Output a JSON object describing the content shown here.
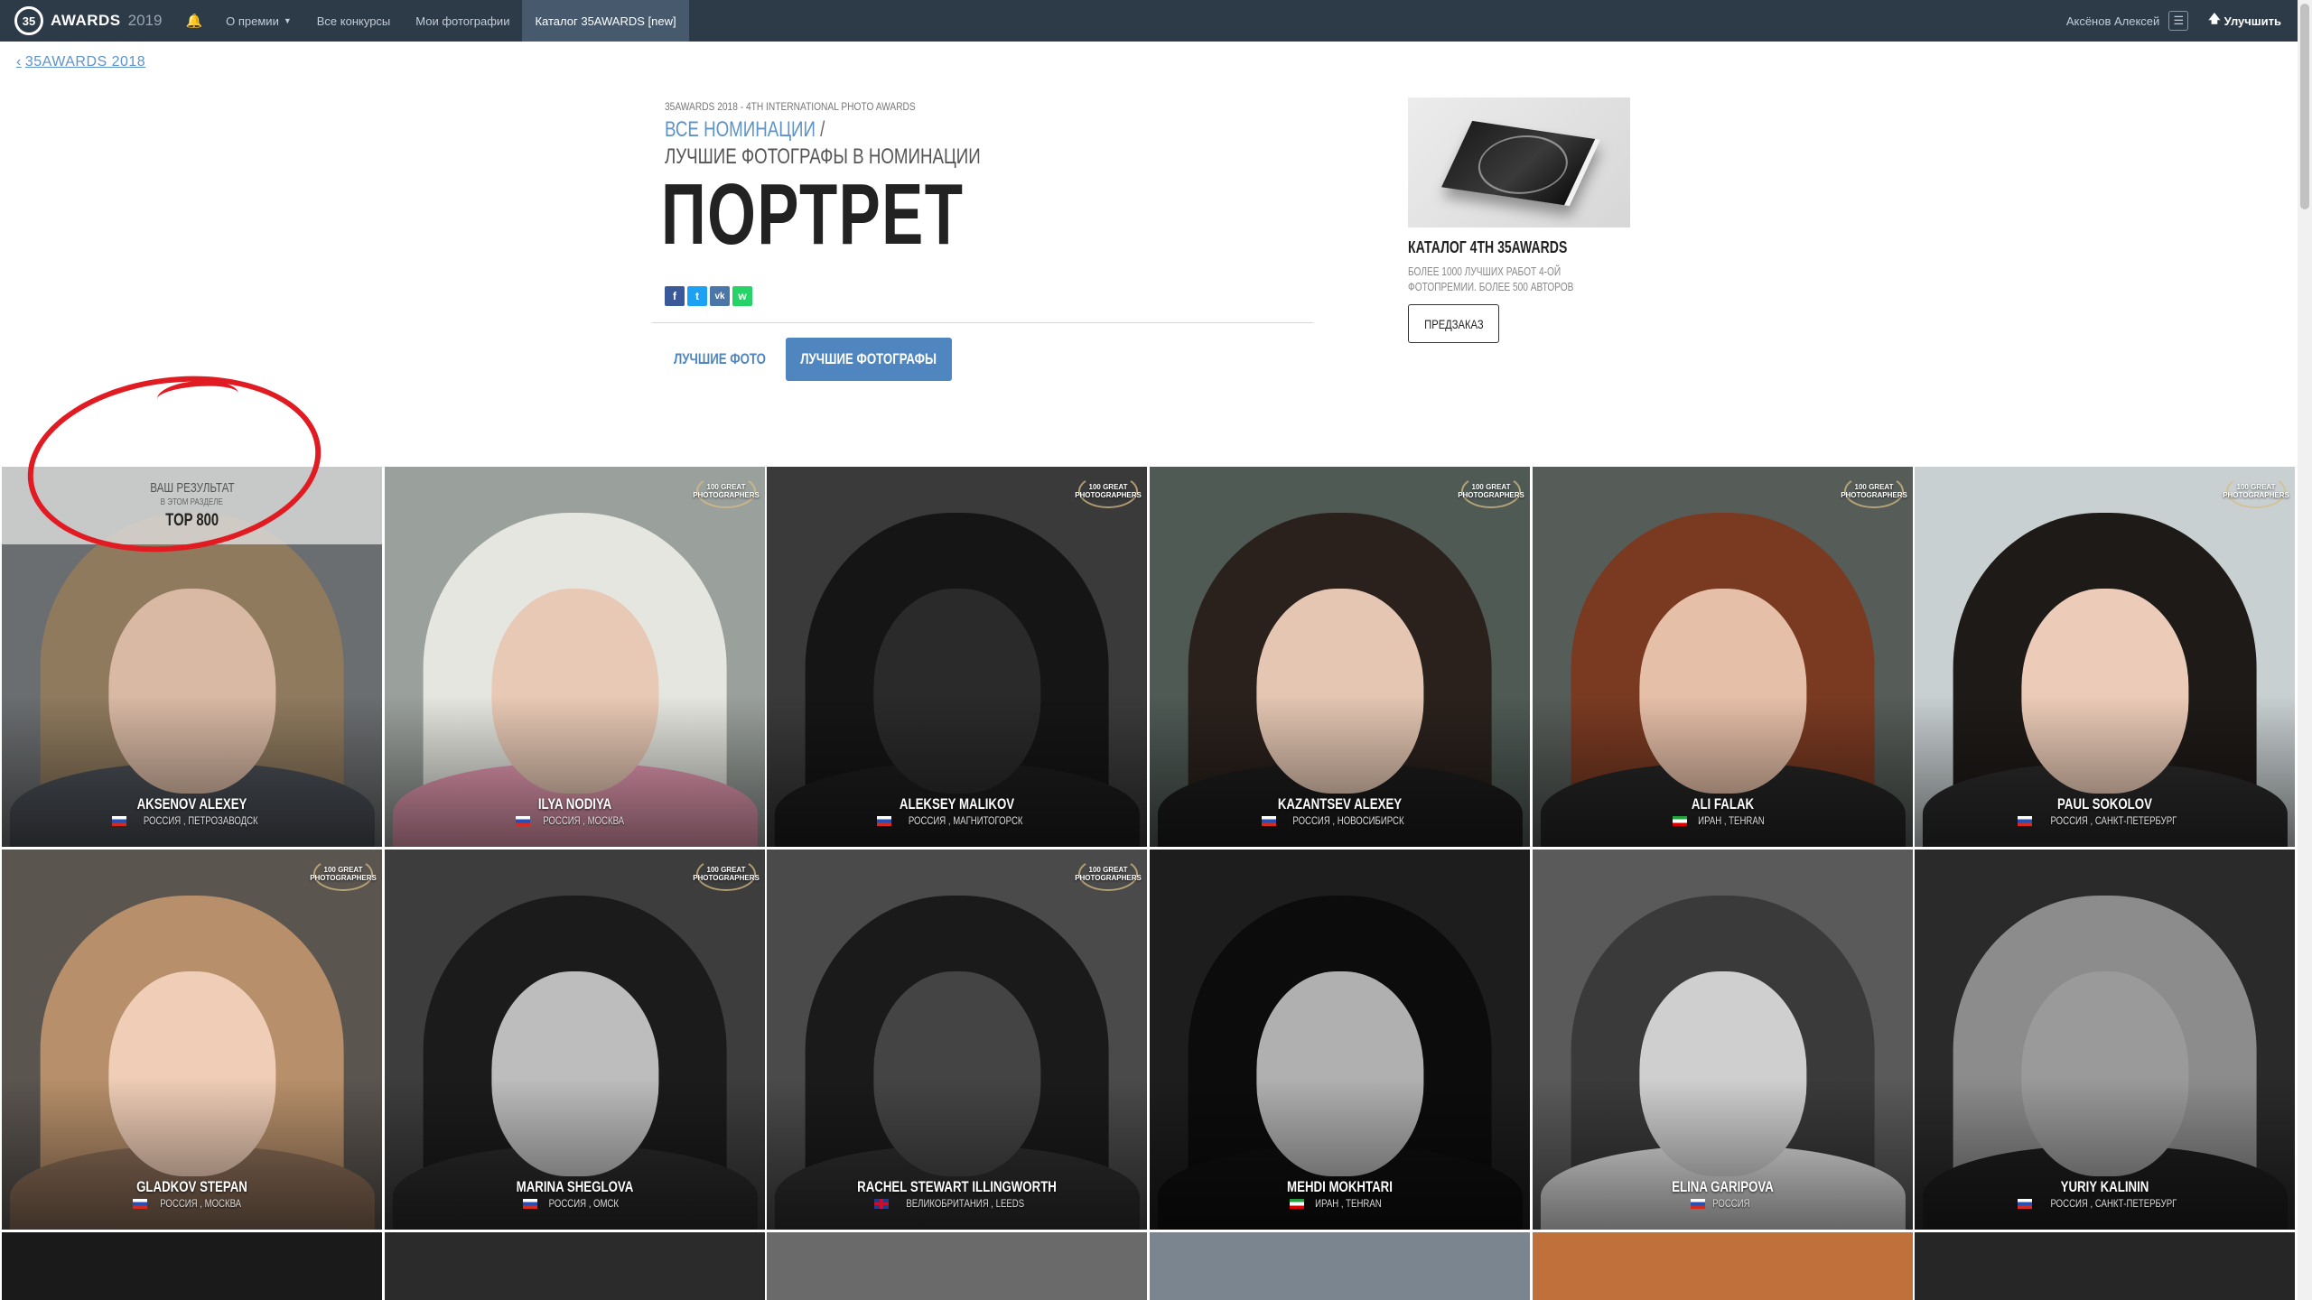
{
  "topbar": {
    "logo_text": "AWARDS",
    "logo_year": "2019",
    "nav": [
      {
        "label": "О премии"
      },
      {
        "label": "Все конкурсы"
      },
      {
        "label": "Мои фотографии"
      },
      {
        "label": "Каталог 35AWARDS [new]"
      }
    ],
    "user_name": "Аксёнов Алексей",
    "upgrade_label": "Улучшить"
  },
  "breadcrumb": {
    "back_label": "35AWARDS 2018"
  },
  "header": {
    "event_label": "35AWARDS 2018 - 4TH INTERNATIONAL PHOTO AWARDS",
    "all_nominations": "ВСЕ НОМИНАЦИИ",
    "slash": " /",
    "subtitle": "ЛУЧШИЕ ФОТОГРАФЫ В НОМИНАЦИИ",
    "title": "ПОРТРЕТ"
  },
  "share": {
    "facebook": "f",
    "twitter": "t",
    "vk": "vk",
    "whatsapp": "w"
  },
  "tabs": {
    "best_photo": "ЛУЧШИЕ ФОТО",
    "best_photographers": "ЛУЧШИЕ ФОТОГРАФЫ"
  },
  "promo": {
    "title": "КАТАЛОГ 4TH 35AWARDS",
    "description": "БОЛЕЕ 1000 ЛУЧШИХ РАБОТ 4-ОЙ ФОТОПРЕМИИ. БОЛЕЕ 500 АВТОРОВ",
    "button": "ПРЕДЗАКАЗ"
  },
  "result_banner": {
    "line1": "ВАШ РЕЗУЛЬТАТ",
    "line2": "В ЭТОМ РАЗДЕЛЕ",
    "line3": "TOP 800"
  },
  "badge_text": "100 GREAT PHOTOGRAPHERS",
  "photographers": [
    {
      "name": "AKSENOV ALEXEY",
      "location": "РОССИЯ , ПЕТРОЗАВОДСК",
      "flag": "ru"
    },
    {
      "name": "ILYA NODIYA",
      "location": "РОССИЯ , МОСКВА",
      "flag": "ru"
    },
    {
      "name": "ALEKSEY MALIKOV",
      "location": "РОССИЯ , МАГНИТОГОРСК",
      "flag": "ru"
    },
    {
      "name": "KAZANTSEV ALEXEY",
      "location": "РОССИЯ , НОВОСИБИРСК",
      "flag": "ru"
    },
    {
      "name": "ALI FALAK",
      "location": "ИРАН , TEHRAN",
      "flag": "ir"
    },
    {
      "name": "PAUL SOKOLOV",
      "location": "РОССИЯ , САНКТ-ПЕТЕРБУРГ",
      "flag": "ru"
    },
    {
      "name": "GLADKOV STEPAN",
      "location": "РОССИЯ , МОСКВА",
      "flag": "ru"
    },
    {
      "name": "MARINA SHEGLOVA",
      "location": "РОССИЯ , ОМСК",
      "flag": "ru"
    },
    {
      "name": "RACHEL STEWART ILLINGWORTH",
      "location": "ВЕЛИКОБРИТАНИЯ , LEEDS",
      "flag": "gb"
    },
    {
      "name": "MEHDI MOKHTARI",
      "location": "ИРАН , TEHRAN",
      "flag": "ir"
    },
    {
      "name": "ELINA GARIPOVA",
      "location": "РОССИЯ",
      "flag": "ru"
    },
    {
      "name": "YURIY KALININ",
      "location": "РОССИЯ , САНКТ-ПЕТЕРБУРГ",
      "flag": "ru"
    }
  ]
}
